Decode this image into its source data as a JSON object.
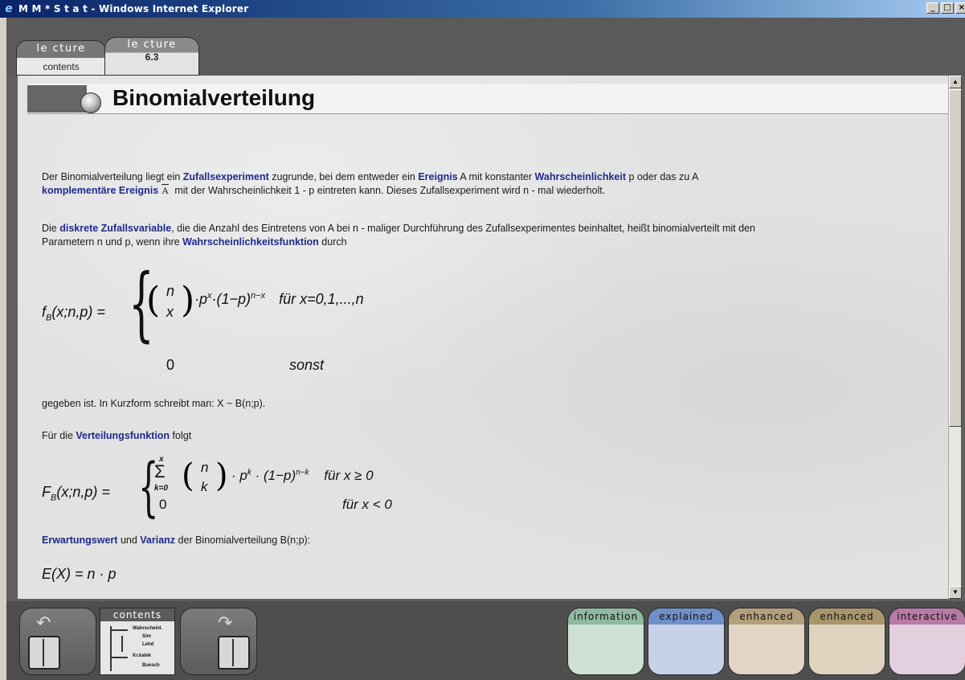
{
  "window": {
    "title": "M M * S t a t - Windows Internet Explorer",
    "minimize": "_",
    "maximize": "□",
    "close": "×"
  },
  "tabs": [
    {
      "line1": "le cture",
      "line2": "contents"
    },
    {
      "line1": "le cture",
      "line2": "6.3"
    }
  ],
  "page": {
    "title": "Binomialverteilung",
    "p1": {
      "t1": "Der Binomialverteilung liegt ein ",
      "l1": "Zufallsexperiment",
      "t2": " zugrunde, bei dem entweder ein ",
      "l2": "Ereignis",
      "t3": " A mit konstanter ",
      "l3": "Wahrscheinlichkeit",
      "t4": " p oder das zu A",
      "l4": "komplementäre Ereignis",
      "sym": "A",
      "t5": " mit der Wahrscheinlichkeit 1 - p eintreten kann. Dieses Zufallsexperiment wird n - mal wiederholt."
    },
    "p2": {
      "t1": "Die ",
      "l1": "diskrete Zufallsvariable",
      "t2": ", die die Anzahl des Eintretens von A bei n - maliger Durchführung des Zufallsexperimentes beinhaltet, heißt binomialverteilt mit den",
      "t3": "Parametern n und p, wenn ihre ",
      "l2": "Wahrscheinlichkeitsfunktion",
      "t4": " durch"
    },
    "formula1": {
      "lhs": "f",
      "lhs_sub": "B",
      "lhs_args": "(x;n,p) =",
      "binom_top": "n",
      "binom_bottom": "x",
      "case1": "·p",
      "case1_exp": "x",
      "case1_rest": "·(1−p)",
      "case1_rest_exp": "n−x",
      "case1_cond": "für x=0,1,...,n",
      "case2": "0",
      "case2_cond": "sonst"
    },
    "p3": "gegeben ist. In Kurzform schreibt man: X ~ B(n;p).",
    "p4": {
      "t1": "Für die ",
      "l1": "Verteilungsfunktion",
      "t2": " folgt"
    },
    "formula2": {
      "lhs": "F",
      "lhs_sub": "B",
      "lhs_args": "(x;n,p) =",
      "sum_top": "x",
      "sum_sym": "Σ",
      "sum_bottom": "k=0",
      "binom_top": "n",
      "binom_bottom": "k",
      "term": "· p",
      "term_exp": "k",
      "term_rest": " · (1−p)",
      "term_rest_exp": "n−k",
      "cond1": "für  x ≥ 0",
      "case2": "0",
      "cond2": "für  x < 0"
    },
    "p5": {
      "l1": "Erwartungswert",
      "t1": " und ",
      "l2": "Varianz",
      "t2": " der Binomialverteilung B(n;p):"
    },
    "formula3": "E(X)  =  n · p"
  },
  "footer": {
    "contents_label": "contents",
    "tree": [
      "Wahrscheinl.",
      "Sim",
      "Lehd",
      "Kr.kalek",
      "Buesch"
    ],
    "modes": [
      {
        "label": "information",
        "bg": "#cfe0d5",
        "head": "#8fb9a0"
      },
      {
        "label": "explained",
        "bg": "#c7d2e8",
        "head": "#6f8fc9"
      },
      {
        "label": "enhanced",
        "bg": "#e0d6c3",
        "head": "#b2a07a"
      },
      {
        "label": "enhanced",
        "bg": "#ddd3bf",
        "head": "#a8956b"
      },
      {
        "label": "interactive",
        "bg": "#e3cfdd",
        "head": "#b97aa6"
      }
    ]
  }
}
